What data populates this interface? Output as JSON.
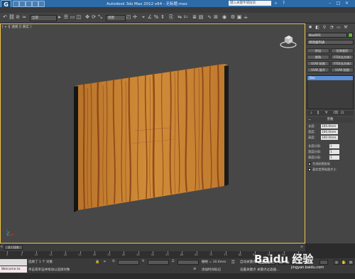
{
  "window": {
    "title": "Autodesk 3ds Max 2012 x64 - 无标题.max",
    "search_placeholder": "键入关键字或短语",
    "logo_glyph": "G"
  },
  "toolbar": {
    "selection_filter": "全部",
    "view_dropdown": "视图"
  },
  "viewport": {
    "label": "[ + ][ 透视 ][ 真实 ]",
    "object": "wood-textured-box",
    "wood_color": "#c9842e"
  },
  "command_panel": {
    "object_name": "Box001",
    "modifier_list": "修改器列表",
    "buttons": [
      "挤出",
      "拉伸变形",
      "倒角",
      "FFD(长方体)",
      "UVW 贴图",
      "FFD(长方体)",
      "UVW 展开",
      "UVW 贴图"
    ],
    "modifier_stack": [
      "Box"
    ],
    "rollout_title": "参数",
    "params": [
      {
        "label": "长度:",
        "value": "100.0mm"
      },
      {
        "label": "宽度:",
        "value": "100.0mm"
      },
      {
        "label": "高度:",
        "value": "100.0mm"
      },
      {
        "label": "长度分段:",
        "value": "1"
      },
      {
        "label": "宽度分段:",
        "value": "1"
      },
      {
        "label": "高度分段:",
        "value": "1"
      }
    ],
    "checkboxes": [
      {
        "label": "生成贴图坐标",
        "checked": true
      },
      {
        "label": "真实世界贴图大小",
        "checked": false
      }
    ]
  },
  "timeline": {
    "slider_label": "0 / 100",
    "ticks": [
      "0",
      "5",
      "10",
      "15",
      "20",
      "25",
      "30",
      "35",
      "40",
      "45",
      "50",
      "55",
      "60",
      "65",
      "70",
      "75",
      "80",
      "85",
      "90",
      "95",
      "100"
    ]
  },
  "status": {
    "maxscript": "Welcome to MAXScript.",
    "selected": "选择了 1 个 对象",
    "prompt": "单击或单击并拖动以选择对象",
    "grid": "栅格 = 10.0mm",
    "add_time_tag": "添加时间标记",
    "auto_key": "自动关键点",
    "set_key": "设置关键点",
    "selection_set": "选定对象",
    "key_filters": "关键点过滤器..."
  },
  "watermark": {
    "brand": "Baidu 经验",
    "sub": "jingyan.baidu.com"
  }
}
